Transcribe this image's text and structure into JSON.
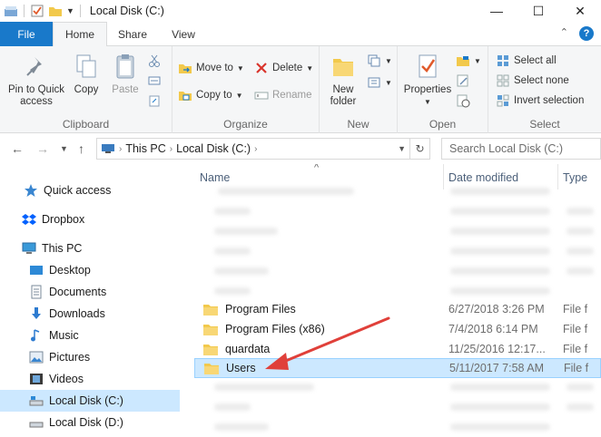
{
  "window": {
    "title": "Local Disk (C:)",
    "controls": {
      "minimize": "—",
      "maximize": "☐",
      "close": "✕"
    }
  },
  "tabs": [
    "File",
    "Home",
    "Share",
    "View"
  ],
  "ribbon": {
    "clipboard": {
      "label": "Clipboard",
      "pin": "Pin to Quick\naccess",
      "copy": "Copy",
      "paste": "Paste"
    },
    "organize": {
      "label": "Organize",
      "move_to": "Move to",
      "copy_to": "Copy to",
      "delete": "Delete",
      "rename": "Rename"
    },
    "new": {
      "label": "New",
      "new_folder": "New\nfolder"
    },
    "open": {
      "label": "Open",
      "properties": "Properties"
    },
    "select": {
      "label": "Select",
      "select_all": "Select all",
      "select_none": "Select none",
      "invert": "Invert selection"
    }
  },
  "address": {
    "crumbs": [
      "This PC",
      "Local Disk (C:)"
    ],
    "search_placeholder": "Search Local Disk (C:)"
  },
  "nav": [
    {
      "label": "Quick access",
      "icon": "star-icon"
    },
    {
      "label": "Dropbox",
      "icon": "dropbox-icon"
    },
    {
      "label": "This PC",
      "icon": "monitor-icon"
    },
    {
      "label": "Desktop",
      "icon": "desktop-icon"
    },
    {
      "label": "Documents",
      "icon": "documents-icon"
    },
    {
      "label": "Downloads",
      "icon": "downloads-icon"
    },
    {
      "label": "Music",
      "icon": "music-icon"
    },
    {
      "label": "Pictures",
      "icon": "pictures-icon"
    },
    {
      "label": "Videos",
      "icon": "videos-icon"
    },
    {
      "label": "Local Disk (C:)",
      "icon": "drive-icon"
    },
    {
      "label": "Local Disk (D:)",
      "icon": "drive-icon"
    }
  ],
  "columns": {
    "name": "Name",
    "date": "Date modified",
    "type": "Type"
  },
  "files": [
    {
      "name": "Program Files",
      "date": "6/27/2018 3:26 PM",
      "type": "File f"
    },
    {
      "name": "Program Files (x86)",
      "date": "7/4/2018 6:14 PM",
      "type": "File f"
    },
    {
      "name": "quardata",
      "date": "11/25/2016 12:17...",
      "type": "File f"
    },
    {
      "name": "Users",
      "date": "5/11/2017 7:58 AM",
      "type": "File f"
    }
  ],
  "colors": {
    "accent": "#1979ca",
    "selection": "#cce8ff",
    "folder": "#f2c94c",
    "arrow": "#e0403a"
  }
}
